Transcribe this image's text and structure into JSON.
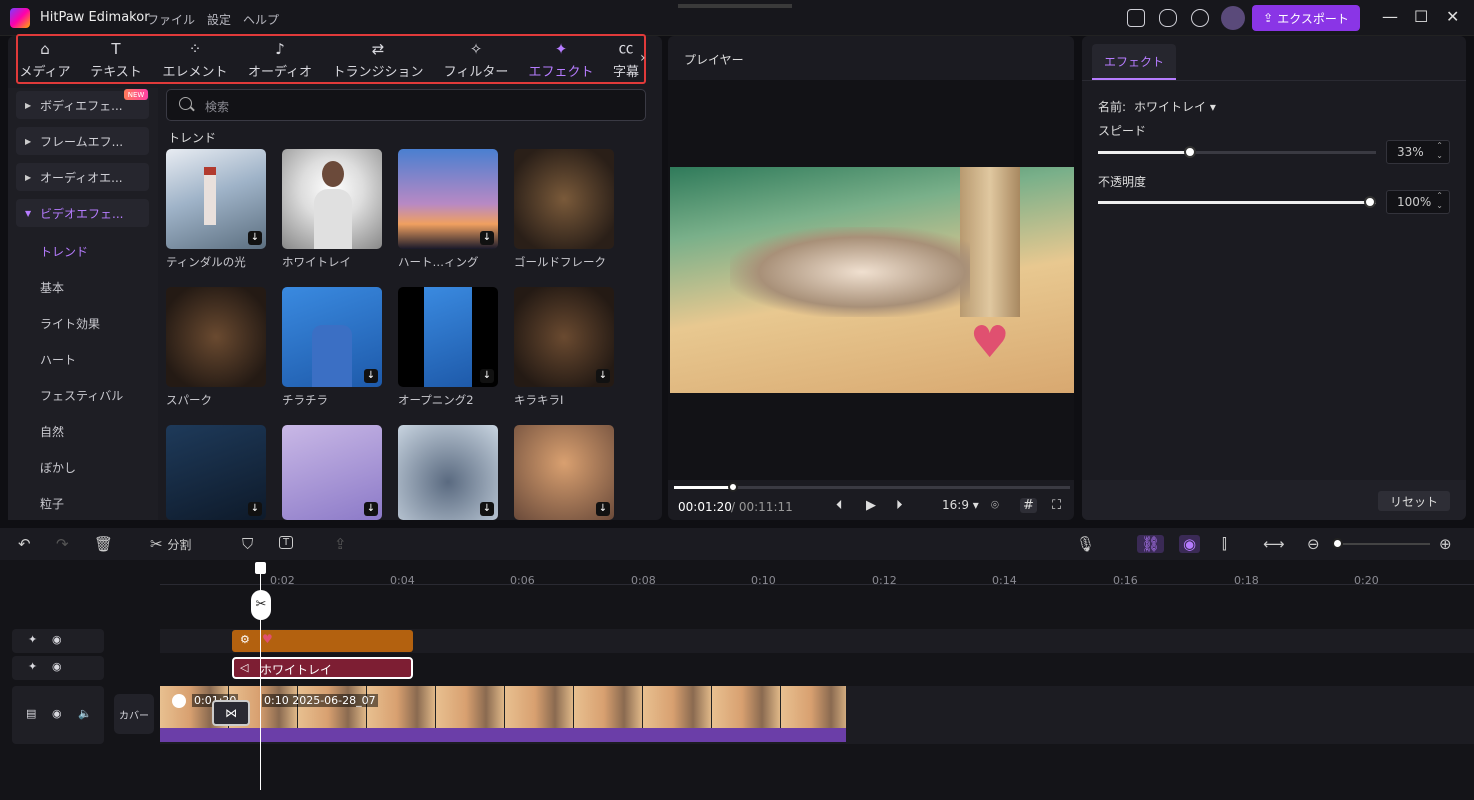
{
  "titlebar": {
    "app_name": "HitPaw Edimakor",
    "menu": [
      "ファイル",
      "設定",
      "ヘルプ"
    ],
    "export_label": "エクスポート"
  },
  "tabs": [
    {
      "label": "メディア",
      "icon": "media-icon"
    },
    {
      "label": "テキスト",
      "icon": "text-icon"
    },
    {
      "label": "エレメント",
      "icon": "element-icon"
    },
    {
      "label": "オーディオ",
      "icon": "audio-icon"
    },
    {
      "label": "トランジション",
      "icon": "transition-icon"
    },
    {
      "label": "フィルター",
      "icon": "filter-icon"
    },
    {
      "label": "エフェクト",
      "icon": "effect-icon",
      "active": true
    },
    {
      "label": "字幕",
      "icon": "subtitle-icon"
    }
  ],
  "sidebar": {
    "categories": [
      "ボディエフェ...",
      "フレームエフ...",
      "オーディオエ...",
      "ビデオエフェ..."
    ],
    "new_badge": "NEW",
    "subs": [
      "トレンド",
      "基本",
      "ライト効果",
      "ハート",
      "フェスティバル",
      "自然",
      "ぼかし",
      "粒子"
    ]
  },
  "search": {
    "placeholder": "検索"
  },
  "section_title": "トレンド",
  "effects": [
    {
      "label": "ティンダルの光"
    },
    {
      "label": "ホワイトレイ"
    },
    {
      "label": "ハート…ィング"
    },
    {
      "label": "ゴールドフレーク"
    },
    {
      "label": "スパーク"
    },
    {
      "label": "チラチラ"
    },
    {
      "label": "オープニング2"
    },
    {
      "label": "キラキラⅠ"
    },
    {
      "label": ""
    },
    {
      "label": ""
    },
    {
      "label": ""
    },
    {
      "label": ""
    }
  ],
  "player": {
    "title": "プレイヤー",
    "time_current": "00:01:20",
    "time_total": "/ 00:11:11",
    "ratio": "16:9",
    "progress": 0.15
  },
  "properties": {
    "tab": "エフェクト",
    "name_label": "名前:",
    "name_value": "ホワイトレイ",
    "speed_label": "スピード",
    "speed_value": "33%",
    "speed": 0.33,
    "opacity_label": "不透明度",
    "opacity_value": "100%",
    "opacity": 1.0,
    "reset_label": "リセット"
  },
  "timeline": {
    "split_label": "分割",
    "ruler": [
      "0:02",
      "0:04",
      "0:06",
      "0:08",
      "0:10",
      "0:12",
      "0:14",
      "0:16",
      "0:18",
      "0:20"
    ],
    "effect_clip_label": "ホワイトレイ",
    "cover_label": "カバー",
    "video_clip_text": "0:01:20",
    "video_clip_name": "0:10 2025-06-28_07"
  },
  "colors": {
    "accent": "#b67cff",
    "export": "#8a35e6",
    "effect_clip": "#b3610f",
    "effect_clip2": "#7d1e33",
    "audio": "#6b3ea8"
  }
}
